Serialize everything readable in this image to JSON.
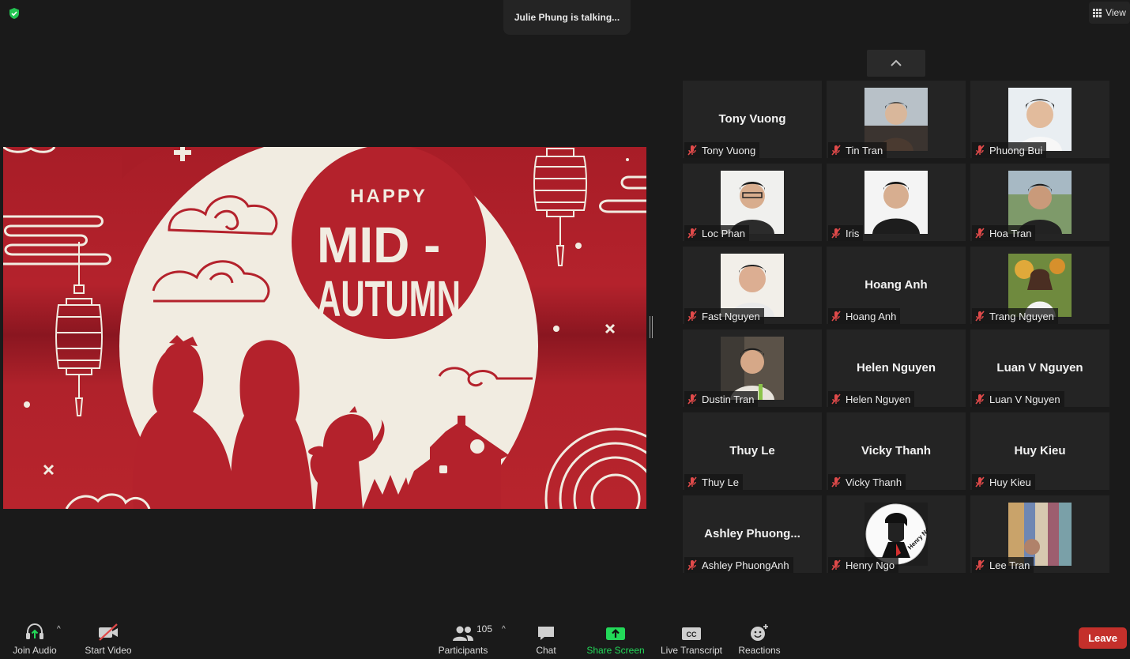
{
  "header": {
    "talking_status": "Julie Phung is talking...",
    "view_label": "View"
  },
  "shared_screen": {
    "headline_small": "HAPPY",
    "headline_line1": "MID -",
    "headline_line2": "AUTUMN"
  },
  "participants": [
    {
      "display": "Tony Vuong",
      "label": "Tony Vuong",
      "video": "off"
    },
    {
      "display": "",
      "label": "Tin Tran",
      "video": "on"
    },
    {
      "display": "",
      "label": "Phuong Bui",
      "video": "on"
    },
    {
      "display": "",
      "label": "Loc Phan",
      "video": "on"
    },
    {
      "display": "",
      "label": "Iris",
      "video": "on"
    },
    {
      "display": "",
      "label": "Hoa Tran",
      "video": "on"
    },
    {
      "display": "",
      "label": "Fast Nguyen",
      "video": "on"
    },
    {
      "display": "Hoang Anh",
      "label": "Hoang Anh",
      "video": "off"
    },
    {
      "display": "",
      "label": "Trang Nguyen",
      "video": "on"
    },
    {
      "display": "",
      "label": "Dustin Tran",
      "video": "on"
    },
    {
      "display": "Helen Nguyen",
      "label": "Helen Nguyen",
      "video": "off"
    },
    {
      "display": "Luan V Nguyen",
      "label": "Luan V Nguyen",
      "video": "off"
    },
    {
      "display": "Thuy Le",
      "label": "Thuy Le",
      "video": "off"
    },
    {
      "display": "Vicky Thanh",
      "label": "Vicky Thanh",
      "video": "off"
    },
    {
      "display": "Huy Kieu",
      "label": "Huy Kieu",
      "video": "off"
    },
    {
      "display": "Ashley  Phuong...",
      "label": "Ashley PhuongAnh",
      "video": "off"
    },
    {
      "display": "",
      "label": "Henry Ngo",
      "video": "on",
      "avatar_text": "Henry Ngô"
    },
    {
      "display": "",
      "label": "Lee Tran",
      "video": "on"
    }
  ],
  "toolbar": {
    "join_audio": "Join Audio",
    "start_video": "Start Video",
    "participants_label": "Participants",
    "participants_count": "105",
    "chat": "Chat",
    "share_screen": "Share Screen",
    "live_transcript": "Live Transcript",
    "cc_text": "CC",
    "reactions": "Reactions",
    "leave": "Leave"
  },
  "colors": {
    "background": "#1a1a1a",
    "tile": "#242424",
    "share_green": "#23d959",
    "leave_red": "#c4302b",
    "muted_red": "#e04a4a",
    "festive_red": "#b4222c",
    "moon_cream": "#f1ece1"
  }
}
